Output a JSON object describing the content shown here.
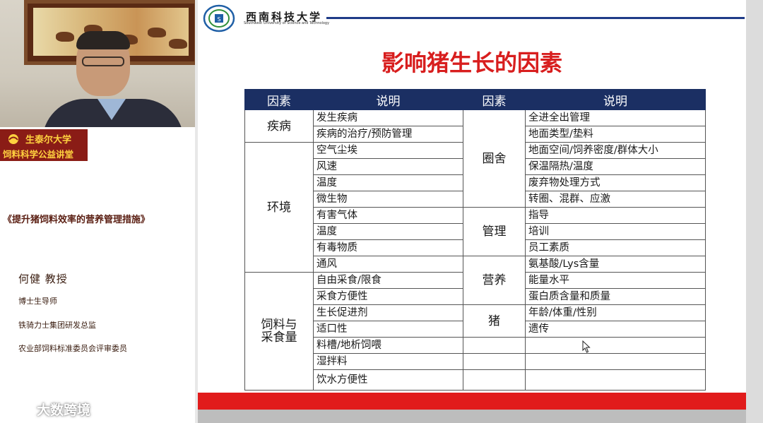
{
  "sidebar": {
    "school_name": "生泰尔大学",
    "school_subtitle": "饲料科学公益讲堂",
    "lecture_title": "《提升猪饲料效率的营养管理措施》",
    "speaker": "何健 教授",
    "credentials": [
      "博士生导师",
      "铁骑力士集团研发总监",
      "农业部饲料标准委员会评审委员"
    ],
    "watermark": "大数跨境"
  },
  "slide": {
    "university_name": "西南科技大学",
    "university_en": "Southwest University of Science and Technology",
    "title": "影响猪生长的因素",
    "table": {
      "headers": [
        "因素",
        "说明",
        "因素",
        "说明"
      ],
      "left_rows": [
        [
          "疾病",
          "发生疾病"
        ],
        [
          "",
          "疾病的治疗/预防管理"
        ],
        [
          "环境",
          "空气尘埃"
        ],
        [
          "",
          "风速"
        ],
        [
          "",
          "温度"
        ],
        [
          "",
          "微生物"
        ],
        [
          "",
          "有害气体"
        ],
        [
          "",
          "温度"
        ],
        [
          "",
          "有毒物质"
        ],
        [
          "",
          "通风"
        ],
        [
          "饲料与采食量",
          "自由采食/限食"
        ],
        [
          "",
          "采食方便性"
        ],
        [
          "",
          "生长促进剂"
        ],
        [
          "",
          "适口性"
        ],
        [
          "",
          "料槽/地析饲喂"
        ],
        [
          "",
          "湿拌料"
        ],
        [
          "",
          "饮水方便性"
        ]
      ],
      "groups_left": [
        {
          "factor": "疾病",
          "items": [
            "发生疾病",
            "疾病的治疗/预防管理"
          ]
        },
        {
          "factor": "环境",
          "items": [
            "空气尘埃",
            "风速",
            "温度",
            "微生物",
            "有害气体",
            "温度",
            "有毒物质",
            "通风"
          ]
        },
        {
          "factor_line1": "饲料与",
          "factor_line2": "采食量",
          "items": [
            "自由采食/限食",
            "采食方便性",
            "生长促进剂",
            "适口性",
            "料槽/地析饲喂",
            "湿拌料",
            "饮水方便性"
          ]
        }
      ],
      "groups_right": [
        {
          "factor": "圈舍",
          "items": [
            "全进全出管理",
            "地面类型/垫料",
            "地面空间/饲养密度/群体大小",
            "保温隔热/温度",
            "废弃物处理方式",
            "转圈、混群、应激"
          ]
        },
        {
          "factor": "管理",
          "items": [
            "指导",
            "培训",
            "员工素质"
          ]
        },
        {
          "factor": "营养",
          "items": [
            "氨基酸/Lys含量",
            "能量水平",
            "蛋白质含量和质量"
          ]
        },
        {
          "factor": "猪",
          "items": [
            "年龄/体重/性别",
            "遗传"
          ]
        }
      ]
    }
  },
  "colors": {
    "title_red": "#d81e1e",
    "header_navy": "#1b2f63",
    "logo_red": "#8a1c16",
    "logo_gold": "#ffd23f"
  }
}
